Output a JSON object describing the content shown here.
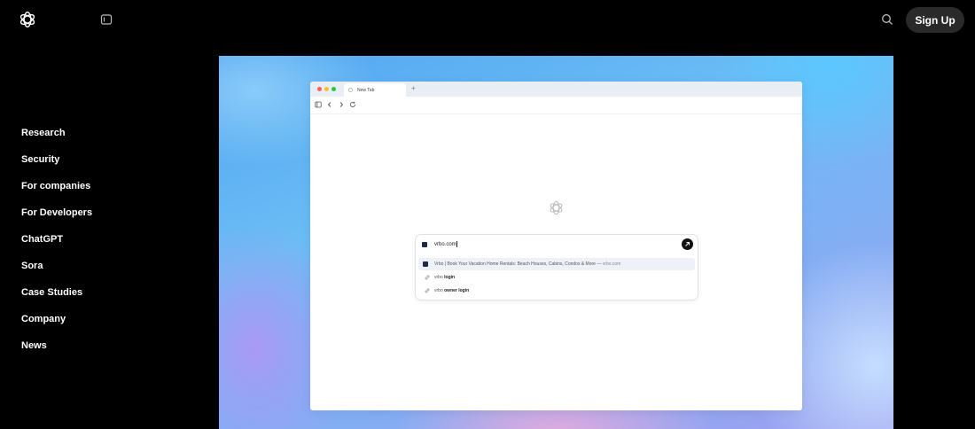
{
  "header": {
    "logo_icon": "openai-logo-icon",
    "sidebar_toggle_icon": "sidebar-toggle-icon",
    "search_icon": "search-icon",
    "signup_label": "Sign Up"
  },
  "nav": {
    "items": [
      {
        "label": "Research"
      },
      {
        "label": "Security"
      },
      {
        "label": "For companies"
      },
      {
        "label": "For Developers"
      },
      {
        "label": "ChatGPT"
      },
      {
        "label": "Sora"
      },
      {
        "label": "Case Studies"
      },
      {
        "label": "Company"
      },
      {
        "label": "News"
      }
    ]
  },
  "browser_mock": {
    "tab_label": "New Tab",
    "new_tab_symbol": "+",
    "omnibox_value": "vrbo.com",
    "suggestions": [
      {
        "title": "Vrbo | Book Your Vacation Home Rentals: Beach Houses, Cabins, Condos & More",
        "separator": " — ",
        "url": "vrbo.com"
      },
      {
        "prefix": "vrbo ",
        "bold": "login"
      },
      {
        "prefix": "vrbo ",
        "bold": "owner login"
      }
    ]
  },
  "colors": {
    "background": "#000000",
    "signup_bg": "#2a2a2a",
    "traffic_red": "#ff5f57",
    "traffic_yellow": "#febc2e",
    "traffic_green": "#28c840"
  }
}
